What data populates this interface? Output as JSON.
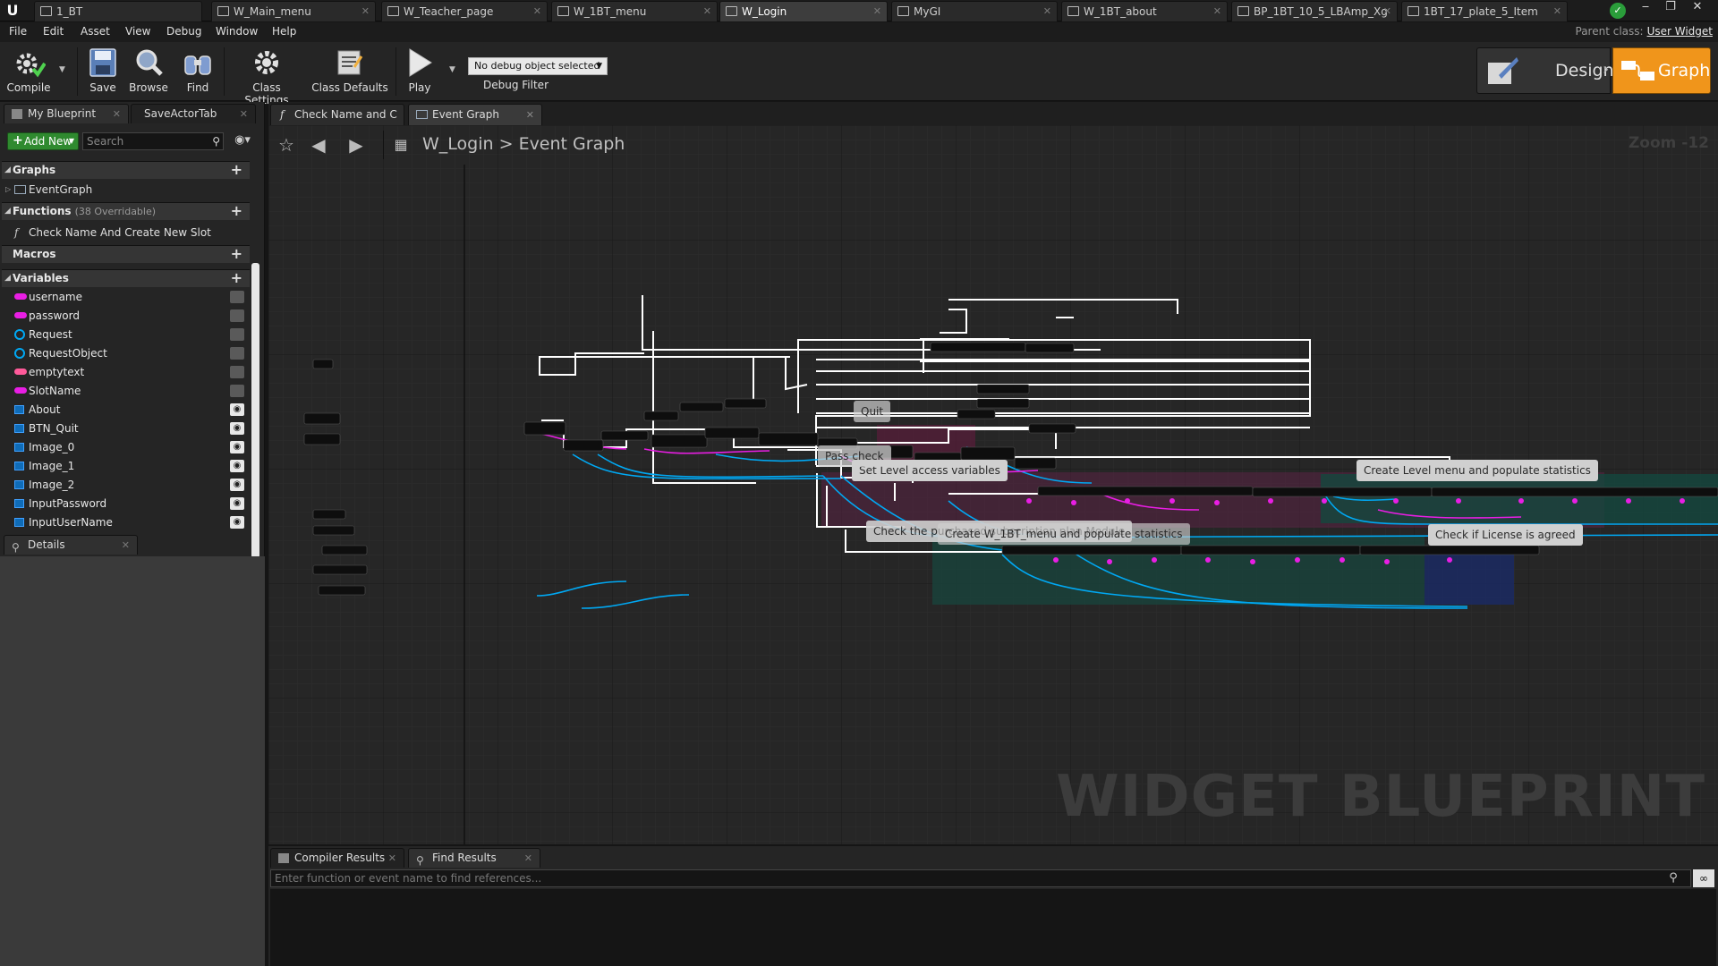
{
  "titlebar": {
    "tabs": [
      {
        "label": "1_BT",
        "active": false
      },
      {
        "label": "W_Main_menu",
        "active": false
      },
      {
        "label": "W_Teacher_page",
        "active": false
      },
      {
        "label": "W_1BT_menu",
        "active": false
      },
      {
        "label": "W_Login",
        "active": true
      },
      {
        "label": "MyGI",
        "active": false
      },
      {
        "label": "W_1BT_about",
        "active": false
      },
      {
        "label": "BP_1BT_10_5_LBAmp_Xg",
        "active": false
      },
      {
        "label": "1BT_17_plate_5_Item",
        "active": false
      }
    ]
  },
  "menubar": {
    "items": [
      "File",
      "Edit",
      "Asset",
      "View",
      "Debug",
      "Window",
      "Help"
    ],
    "parent_class_label": "Parent class:",
    "parent_class_value": "User Widget"
  },
  "toolbar": {
    "compile": "Compile",
    "save": "Save",
    "browse": "Browse",
    "find": "Find",
    "class_settings": "Class Settings",
    "class_defaults": "Class Defaults",
    "play": "Play",
    "debug_select": "No debug object selected",
    "debug_filter": "Debug Filter",
    "designer": "Designer",
    "graph": "Graph"
  },
  "left_panel": {
    "tabs": [
      "My Blueprint",
      "SaveActorTab"
    ],
    "add_new": "Add New",
    "search_placeholder": "Search",
    "graphs_header": "Graphs",
    "graphs_items": [
      "EventGraph"
    ],
    "functions_header": "Functions",
    "functions_sub": "(38 Overridable)",
    "functions_items": [
      "Check Name And Create New Slot"
    ],
    "macros_header": "Macros",
    "variables_header": "Variables",
    "variables": [
      {
        "name": "username",
        "kind": "pill",
        "color": "#e91ee4"
      },
      {
        "name": "password",
        "kind": "pill",
        "color": "#e91ee4"
      },
      {
        "name": "Request",
        "kind": "ring",
        "color": "#00a8f3"
      },
      {
        "name": "RequestObject",
        "kind": "ring",
        "color": "#00a8f3"
      },
      {
        "name": "emptytext",
        "kind": "pill",
        "color": "#ff5a9a"
      },
      {
        "name": "SlotName",
        "kind": "pill",
        "color": "#e91ee4"
      },
      {
        "name": "About",
        "kind": "box",
        "color": "#0f6cb8"
      },
      {
        "name": "BTN_Quit",
        "kind": "box",
        "color": "#0f6cb8"
      },
      {
        "name": "Image_0",
        "kind": "box",
        "color": "#0f6cb8"
      },
      {
        "name": "Image_1",
        "kind": "box",
        "color": "#0f6cb8"
      },
      {
        "name": "Image_2",
        "kind": "box",
        "color": "#0f6cb8"
      },
      {
        "name": "InputPassword",
        "kind": "box",
        "color": "#0f6cb8"
      },
      {
        "name": "InputUserName",
        "kind": "box",
        "color": "#0f6cb8"
      }
    ],
    "details_tab": "Details"
  },
  "graph_tabs": [
    "Check Name and C",
    "Event Graph"
  ],
  "graph": {
    "breadcrumb_root": "W_Login",
    "breadcrumb_sep": ">",
    "breadcrumb_leaf": "Event Graph",
    "zoom": "Zoom -12",
    "watermark": "WIDGET BLUEPRINT",
    "comments": [
      "Set Level access variables",
      "Create Level menu and populate statistics",
      "Check if License is agreed",
      "Check the purchased subscription plan Module",
      "Create W_1BT_menu and populate statistics",
      "Pass check",
      "Quit"
    ]
  },
  "bottom_panel": {
    "tabs": [
      "Compiler Results",
      "Find Results"
    ],
    "find_placeholder": "Enter function or event name to find references..."
  },
  "colors": {
    "exec_wire": "#ffffff",
    "object_wire": "#00a8f3",
    "string_wire": "#e91ee4",
    "graph_accent": "#f0951b"
  }
}
